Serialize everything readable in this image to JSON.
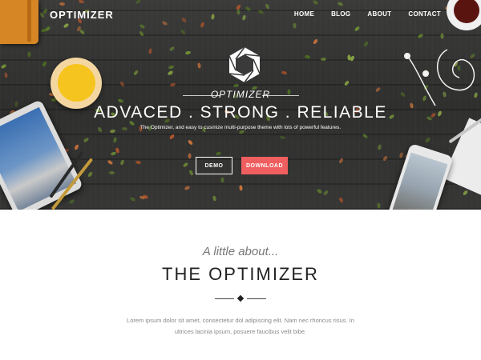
{
  "header": {
    "brand": "OPTIMIZER",
    "nav": [
      "HOME",
      "BLOG",
      "ABOUT",
      "CONTACT"
    ]
  },
  "hero": {
    "logo_word": "OPTIMIZER",
    "headline": "ADVACED . STRONG . RELIABLE",
    "tagline": "The Optimizer, and easy to cusmize multi-purpose theme with lots of powerful features.",
    "buttons": {
      "demo": "DEMO",
      "download": "DOWNLOAD"
    }
  },
  "about": {
    "subtitle": "A little about...",
    "title": "THE OPTIMIZER",
    "text_line1": "Lorem ipsum dolor sit amet, consectetur dol adipiscing elit. Nam nec rhoncus risus. In",
    "text_line2": "ultrices lacinia ipsum, posuere faucibus velit bibe."
  },
  "colors": {
    "accent": "#ef5f5f",
    "background_hero": "#333333",
    "text_dark": "#222222",
    "text_muted": "#888888"
  },
  "icons": [
    "hexagon-logo-icon",
    "diamond-divider-icon"
  ]
}
